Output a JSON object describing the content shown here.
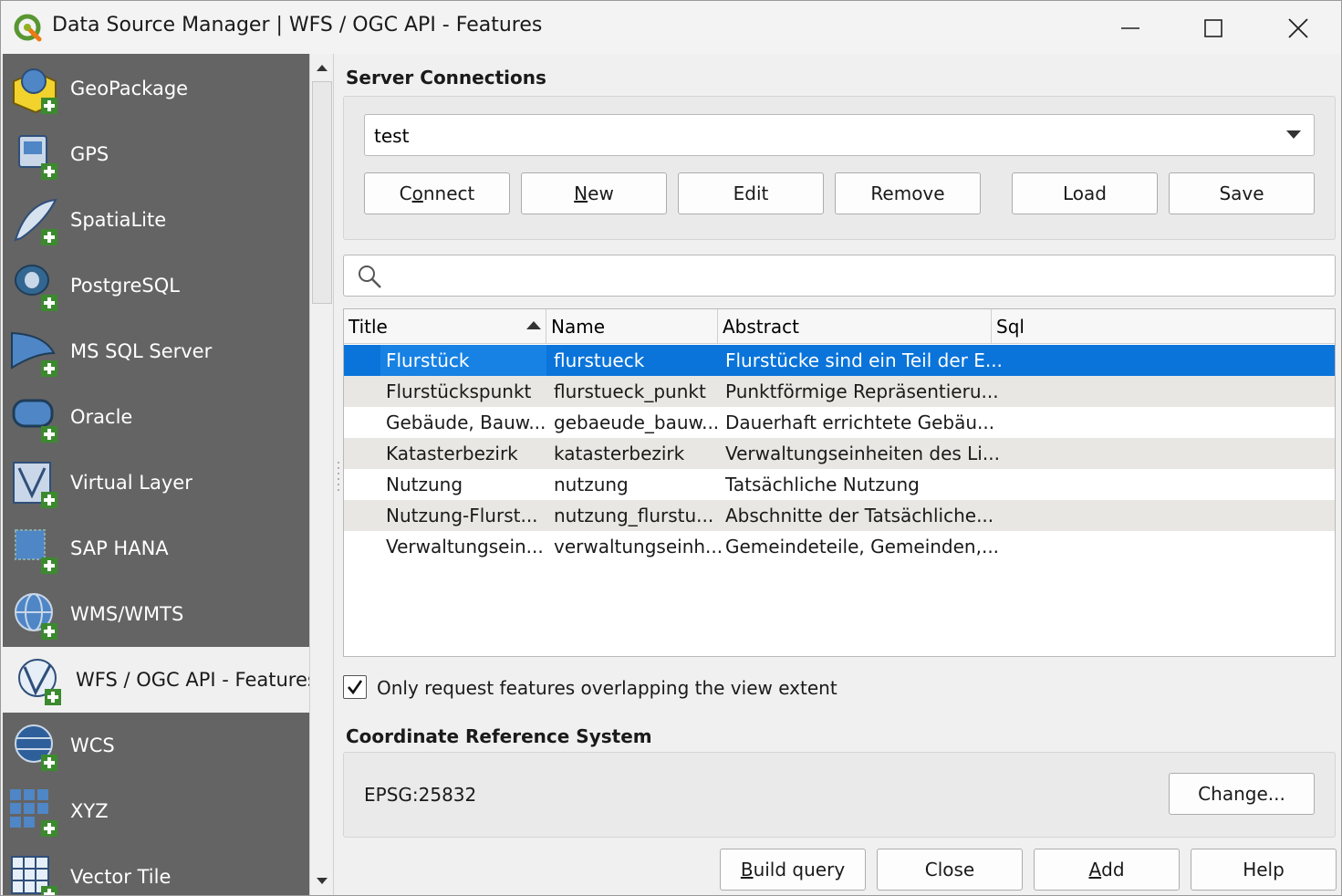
{
  "window": {
    "title": "Data Source Manager | WFS / OGC API - Features",
    "minimize_icon": "minimize-icon",
    "maximize_icon": "maximize-icon",
    "close_icon": "close-icon"
  },
  "sidebar": {
    "items": [
      {
        "label": "GeoPackage",
        "icon": "geopackage-icon"
      },
      {
        "label": "GPS",
        "icon": "gps-icon"
      },
      {
        "label": "SpatiaLite",
        "icon": "spatialite-icon"
      },
      {
        "label": "PostgreSQL",
        "icon": "postgresql-icon"
      },
      {
        "label": "MS SQL Server",
        "icon": "mssql-icon"
      },
      {
        "label": "Oracle",
        "icon": "oracle-icon"
      },
      {
        "label": "Virtual Layer",
        "icon": "virtual-layer-icon"
      },
      {
        "label": "SAP HANA",
        "icon": "sap-hana-icon"
      },
      {
        "label": "WMS/WMTS",
        "icon": "wms-icon"
      },
      {
        "label": "WFS / OGC API - Features",
        "icon": "wfs-icon",
        "active": true
      },
      {
        "label": "WCS",
        "icon": "wcs-icon"
      },
      {
        "label": "XYZ",
        "icon": "xyz-icon"
      },
      {
        "label": "Vector Tile",
        "icon": "vector-tile-icon"
      }
    ]
  },
  "server": {
    "section_title": "Server Connections",
    "selected_connection": "test",
    "buttons": {
      "connect_pre": "C",
      "connect_u": "o",
      "connect_post": "nnect",
      "new_u": "N",
      "new_post": "ew",
      "edit": "Edit",
      "remove": "Remove",
      "load": "Load",
      "save": "Save"
    }
  },
  "search": {
    "placeholder": ""
  },
  "table": {
    "columns": [
      "Title",
      "Name",
      "Abstract",
      "Sql"
    ],
    "sorted_column": "Title",
    "rows": [
      {
        "title": "Flurstück",
        "name": "flurstueck",
        "abstract": "Flurstücke sind ein Teil der E...",
        "sql": "",
        "selected": true
      },
      {
        "title": "Flurstückspunkt",
        "name": "flurstueck_punkt",
        "abstract": "Punktförmige Repräsentieru...",
        "sql": ""
      },
      {
        "title": "Gebäude, Bauw...",
        "name": "gebaeude_bauw...",
        "abstract": "Dauerhaft errichtete Gebäu...",
        "sql": ""
      },
      {
        "title": "Katasterbezirk",
        "name": "katasterbezirk",
        "abstract": "Verwaltungseinheiten des Li...",
        "sql": ""
      },
      {
        "title": "Nutzung",
        "name": "nutzung",
        "abstract": "Tatsächliche Nutzung",
        "sql": ""
      },
      {
        "title": "Nutzung-Flurst...",
        "name": "nutzung_flurstu...",
        "abstract": "Abschnitte der Tatsächliche...",
        "sql": ""
      },
      {
        "title": "Verwaltungsein...",
        "name": "verwaltungseinh...",
        "abstract": "Gemeindeteile, Gemeinden,...",
        "sql": ""
      }
    ]
  },
  "options": {
    "only_request_label": "Only request features overlapping the view extent",
    "only_request_checked": true
  },
  "crs": {
    "section_title": "Coordinate Reference System",
    "value": "EPSG:25832",
    "change_button": "Change..."
  },
  "footer": {
    "build_query_u": "B",
    "build_query_post": "uild query",
    "close": "Close",
    "add_u": "A",
    "add_post": "dd",
    "help": "Help"
  },
  "colors": {
    "sidebar_bg": "#646464",
    "selection": "#0a74da",
    "alt_row": "#e9e7e3"
  }
}
